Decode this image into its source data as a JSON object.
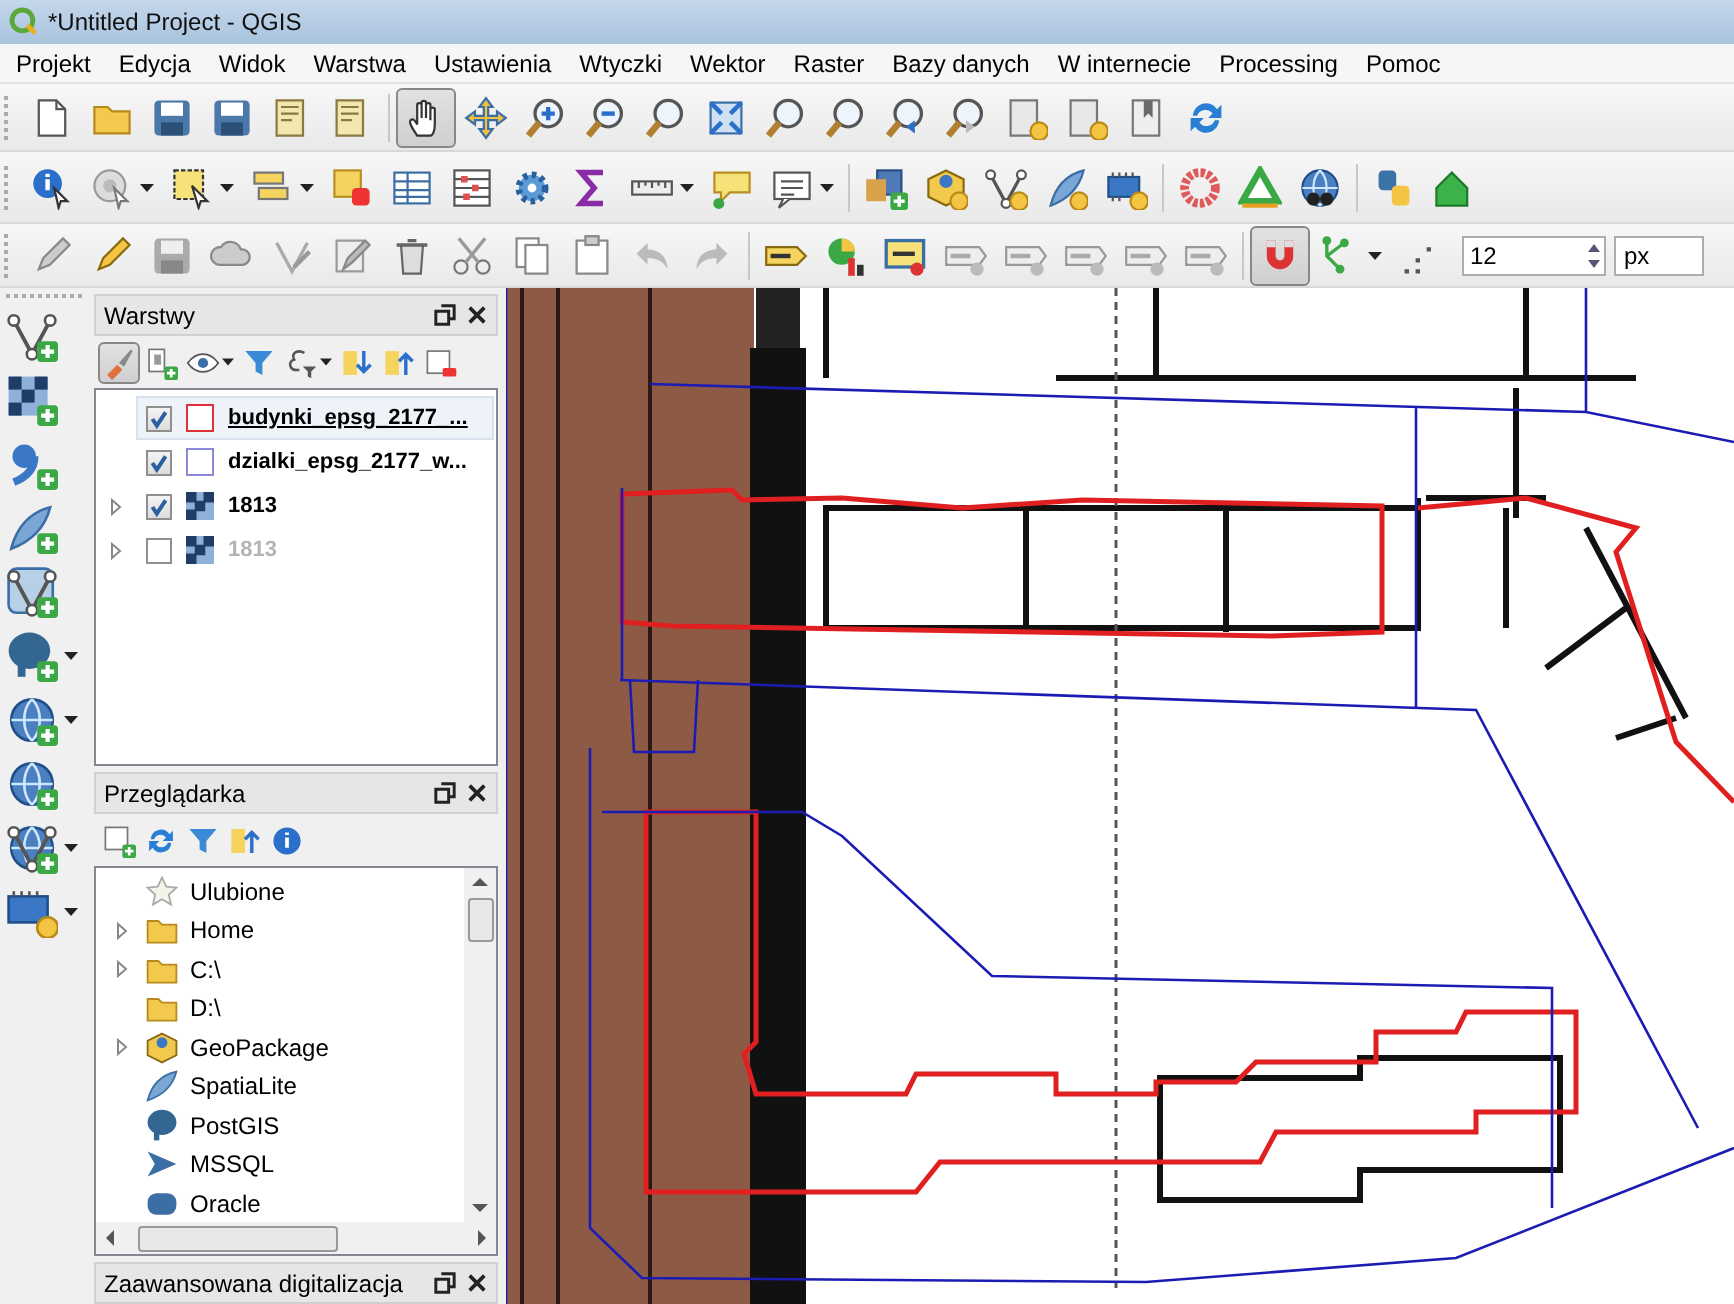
{
  "window": {
    "title": "*Untitled Project - QGIS"
  },
  "menu": [
    "Projekt",
    "Edycja",
    "Widok",
    "Warstwa",
    "Ustawienia",
    "Wtyczki",
    "Wektor",
    "Raster",
    "Bazy danych",
    "W internecie",
    "Processing",
    "Pomoc"
  ],
  "snapping_toolbar": {
    "tolerance_field": {
      "value": "12"
    },
    "unit_select": {
      "value": "px"
    }
  },
  "layers_panel": {
    "title": "Warstwy",
    "layers": [
      {
        "name": "budynki_epsg_2177_...",
        "kind": "vector",
        "checked": true,
        "selected": true,
        "color": "#e0303a"
      },
      {
        "name": "dzialki_epsg_2177_w...",
        "kind": "vector",
        "checked": true,
        "selected": false,
        "color": "#8a8ad8"
      },
      {
        "name": "1813",
        "kind": "raster",
        "checked": true,
        "selected": false
      },
      {
        "name": "1813",
        "kind": "raster",
        "checked": false,
        "selected": false
      }
    ]
  },
  "browser_panel": {
    "title": "Przeglądarka",
    "items": [
      {
        "name": "Ulubione",
        "kind": "favorites",
        "expandable": false
      },
      {
        "name": "Home",
        "kind": "folder",
        "expandable": true
      },
      {
        "name": "C:\\",
        "kind": "folder",
        "expandable": true
      },
      {
        "name": "D:\\",
        "kind": "folder",
        "expandable": false
      },
      {
        "name": "GeoPackage",
        "kind": "geopackage",
        "expandable": true
      },
      {
        "name": "SpatiaLite",
        "kind": "spatialite",
        "expandable": false
      },
      {
        "name": "PostGIS",
        "kind": "postgis",
        "expandable": false
      },
      {
        "name": "MSSQL",
        "kind": "mssql",
        "expandable": false
      },
      {
        "name": "Oracle",
        "kind": "oracle",
        "expandable": false
      }
    ]
  },
  "digitizing_panel": {
    "title": "Zaawansowana digitalizacja"
  }
}
